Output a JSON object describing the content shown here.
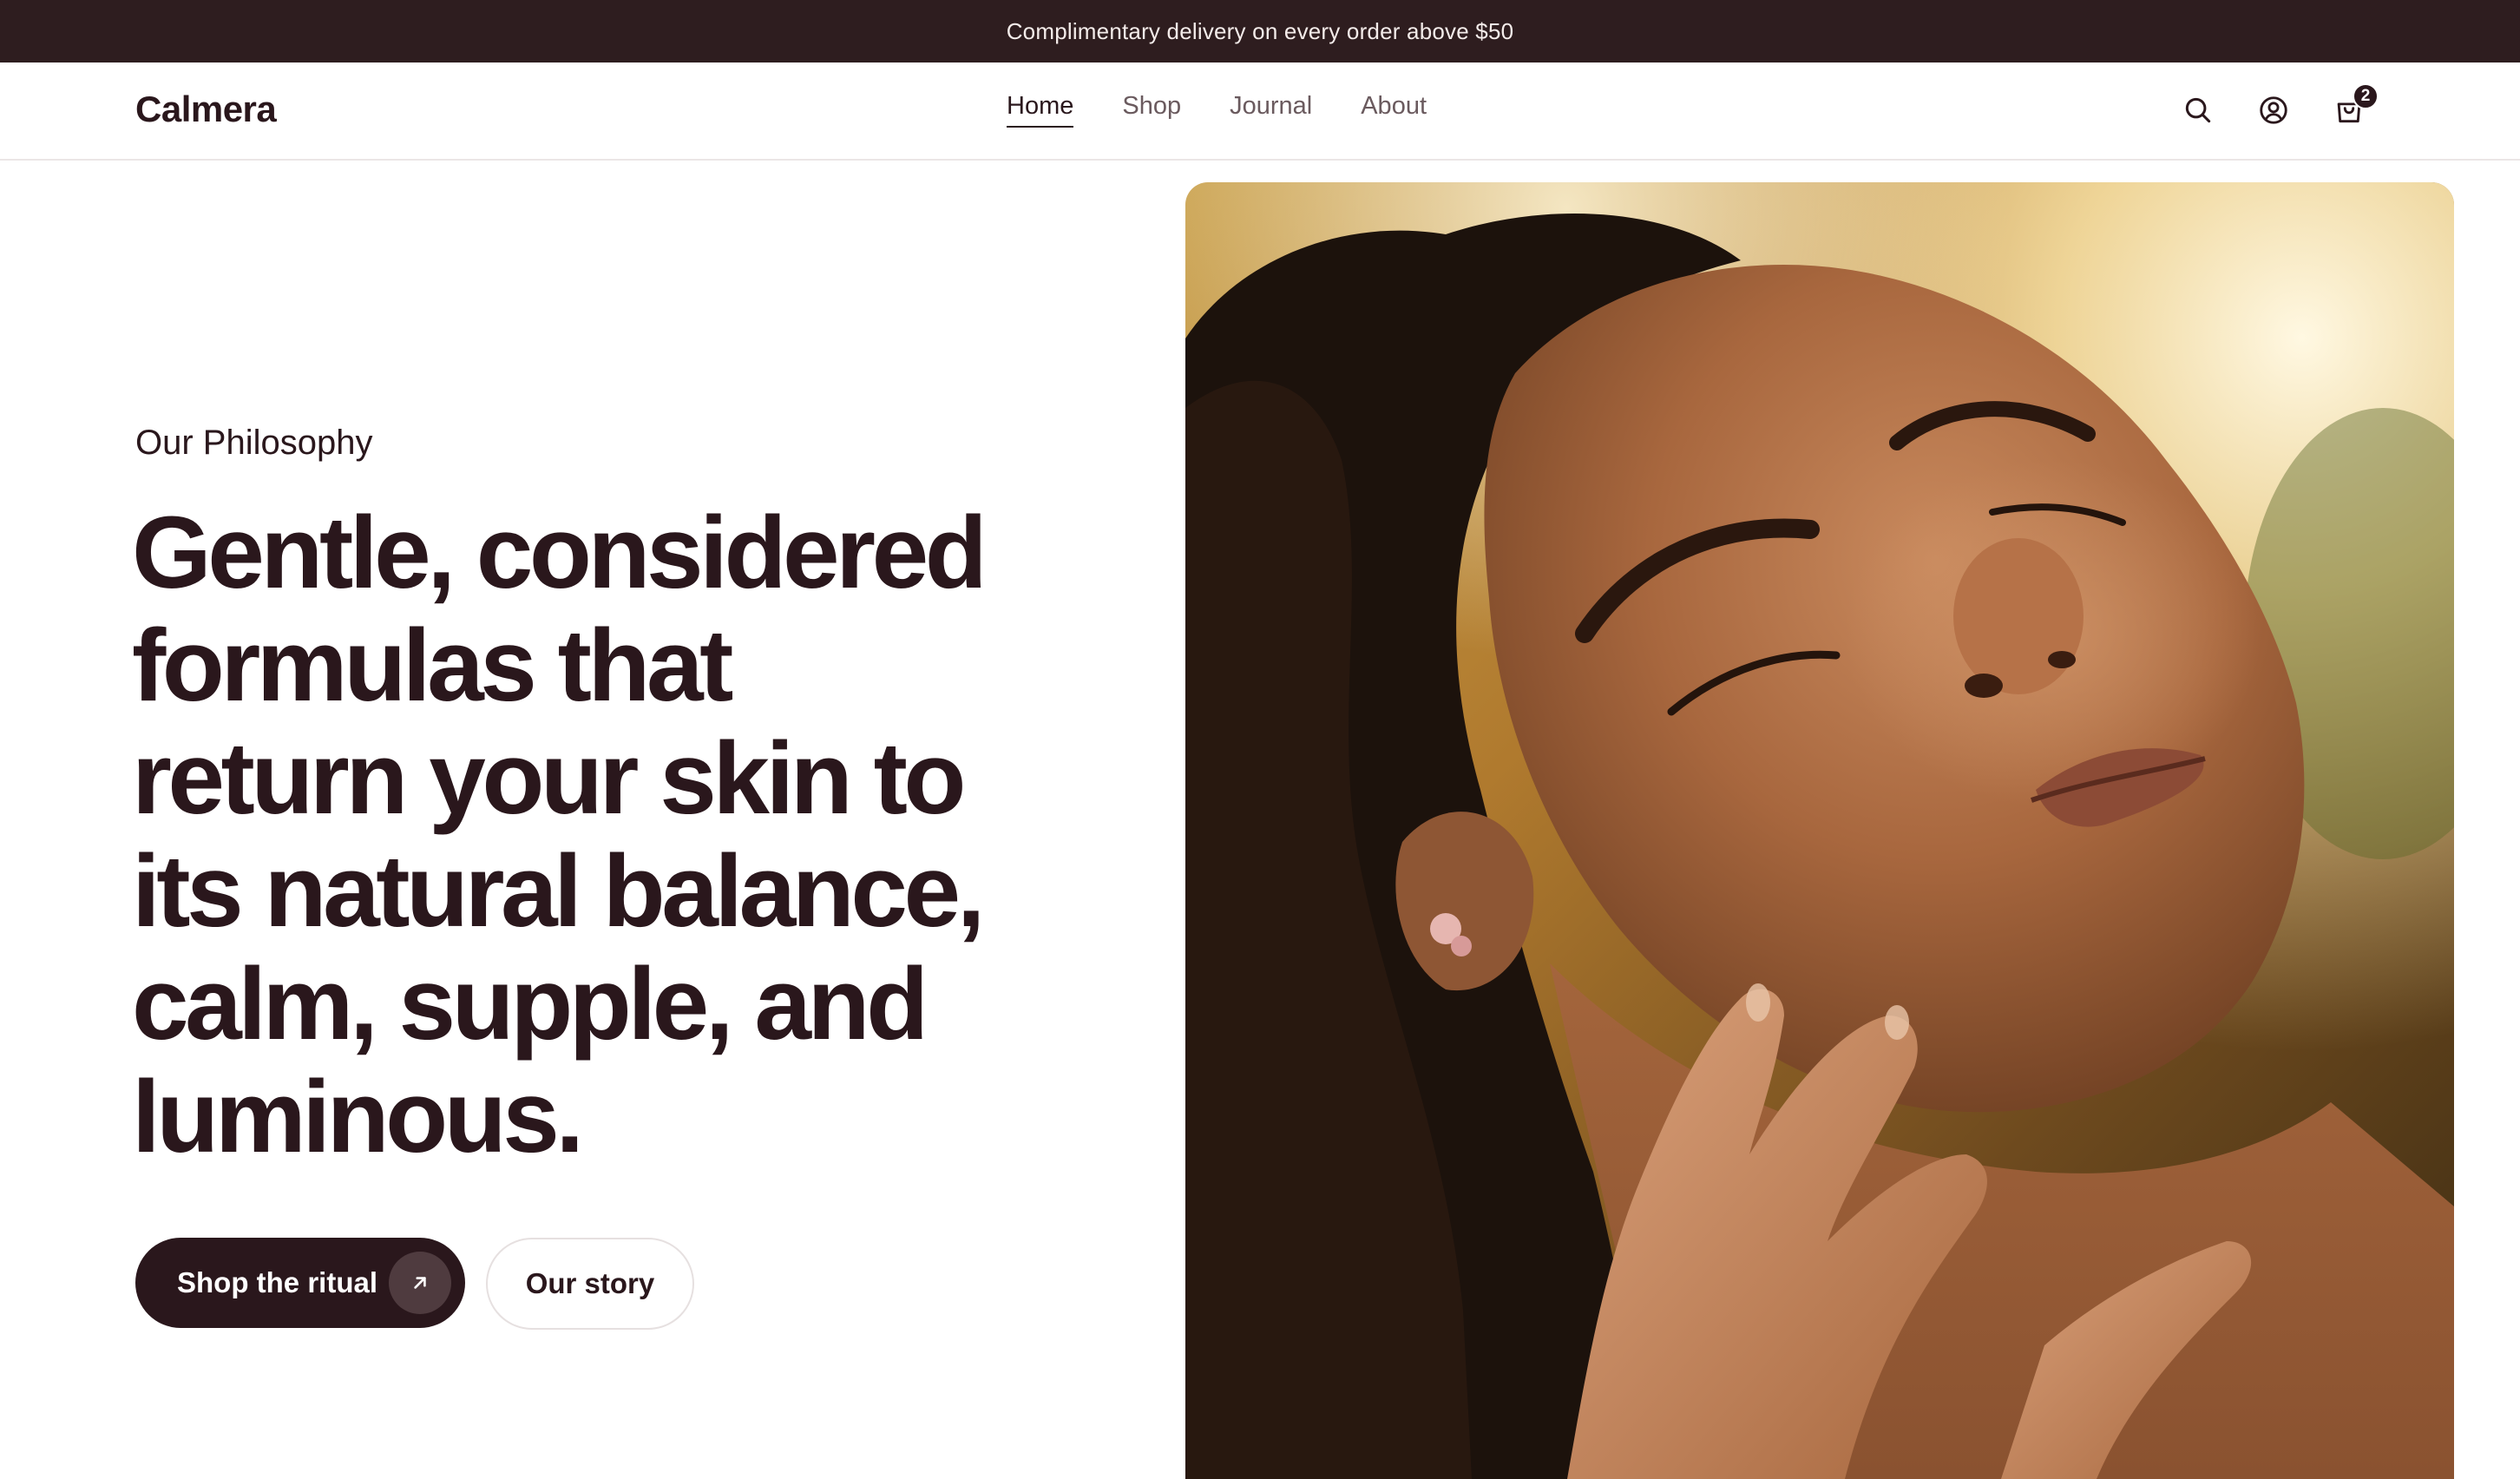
{
  "announcement": {
    "text": "Complimentary delivery on every order above $50"
  },
  "header": {
    "logo": "Calmera",
    "nav": [
      {
        "label": "Home",
        "active": true
      },
      {
        "label": "Shop",
        "active": false
      },
      {
        "label": "Journal",
        "active": false
      },
      {
        "label": "About",
        "active": false
      }
    ],
    "icons": [
      "search-icon",
      "account-icon",
      "cart-icon"
    ],
    "cart_count": "2"
  },
  "hero": {
    "eyebrow": "Our Philosophy",
    "headline_lines": [
      "Gentle, considered",
      "formulas that",
      "return your skin to",
      "its natural balance,",
      "calm, supple, and",
      "luminous."
    ],
    "primary_cta": "Shop the ritual",
    "secondary_cta": "Our story",
    "image_subject": "woman with eyes closed, hand resting under chin, warm golden light"
  },
  "colors": {
    "announcement_bg": "#2e1d1f",
    "text_dark": "#2a171c",
    "nav_muted": "#6a5a5e",
    "cta_arrow_bg": "#4f3b3f"
  }
}
